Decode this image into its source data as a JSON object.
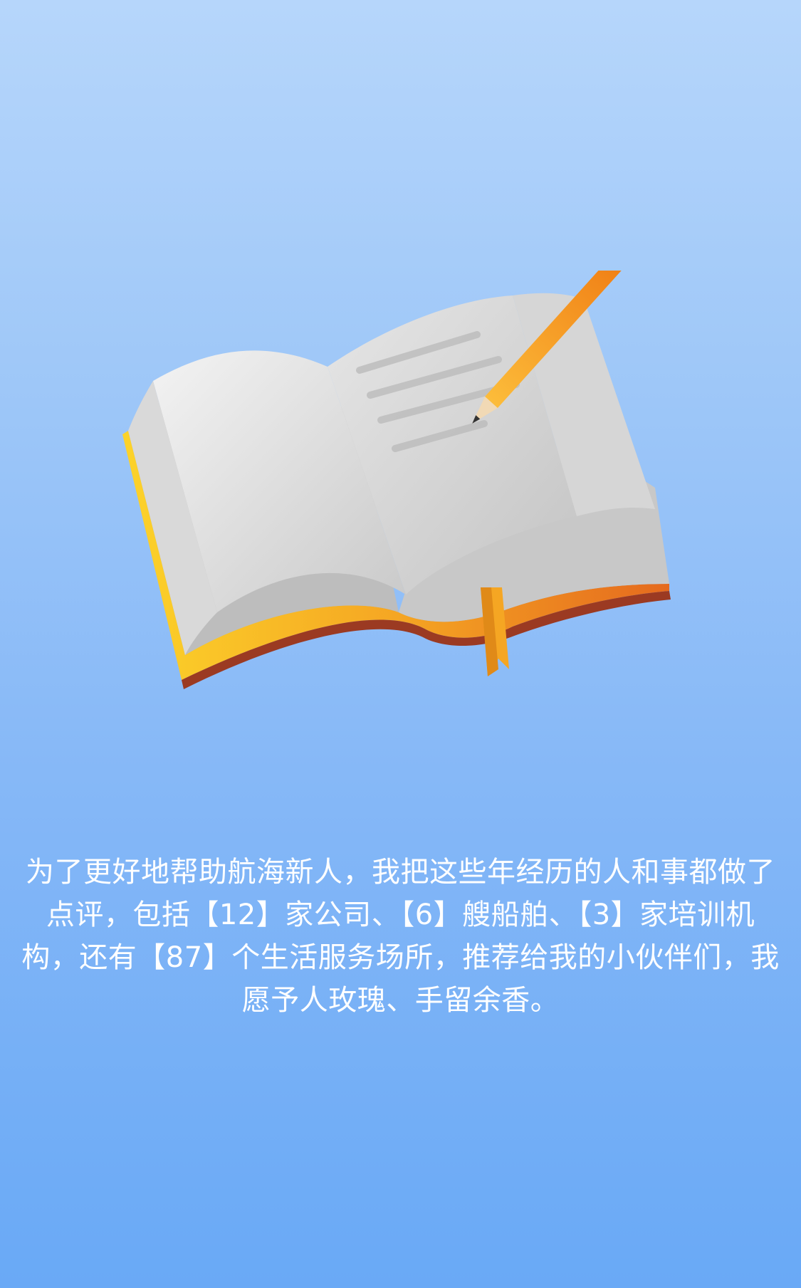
{
  "intro": {
    "text": "为了更好地帮助航海新人，我把这些年经历的人和事都做了点评，包括【12】家公司、【6】艘船舶、【3】家培训机构，还有【87】个生活服务场所，推荐给我的小伙伴们，我愿予人玫瑰、手留余香。"
  },
  "illustration": {
    "icon": "open-book-with-pencil-icon"
  },
  "colors": {
    "background_top": "#b6d6fb",
    "background_bottom": "#69a9f6",
    "text": "#ffffff",
    "book_edge": "#f7b425",
    "pencil": "#f5901f"
  }
}
